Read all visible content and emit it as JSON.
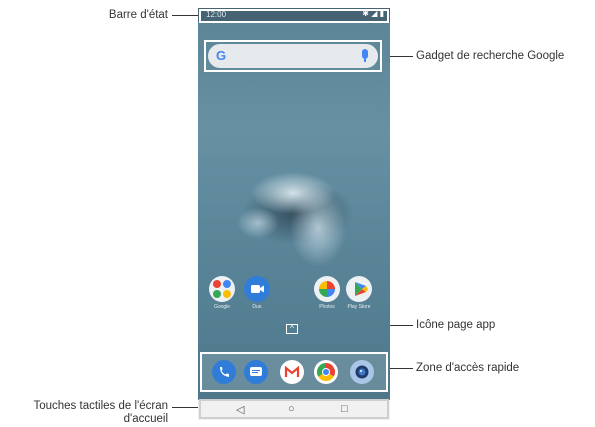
{
  "annotations": {
    "status_bar": "Barre d'état",
    "google_search": "Gadget de recherche Google",
    "app_drawer": "Icône page app",
    "quick_access": "Zone d'accès rapide",
    "home_touch_line1": "Touches tactiles de l'écran",
    "home_touch_line2": "d'accueil"
  },
  "phone": {
    "status_time": "12:00",
    "status_icons": "✱ ◢ ▮",
    "search_logo": "G",
    "drawer_icon_glyph": "^",
    "nav": {
      "back": "◁",
      "home": "○",
      "recents": "□"
    }
  },
  "home_apps": [
    {
      "name": "Google",
      "icon": "google-folder-icon"
    },
    {
      "name": "Duo",
      "icon": "duo-video-icon"
    },
    {
      "name": "Photos",
      "icon": "photos-pinwheel-icon"
    },
    {
      "name": "Play Store",
      "icon": "play-store-icon"
    }
  ],
  "dock_apps": [
    {
      "name": "Phone",
      "icon": "phone-icon"
    },
    {
      "name": "Messages",
      "icon": "messages-icon"
    },
    {
      "name": "Gmail",
      "icon": "gmail-icon"
    },
    {
      "name": "Chrome",
      "icon": "chrome-icon"
    },
    {
      "name": "Camera",
      "icon": "camera-icon"
    }
  ],
  "colors": {
    "google_blue": "#4285f4",
    "annotation_text": "#333333"
  }
}
